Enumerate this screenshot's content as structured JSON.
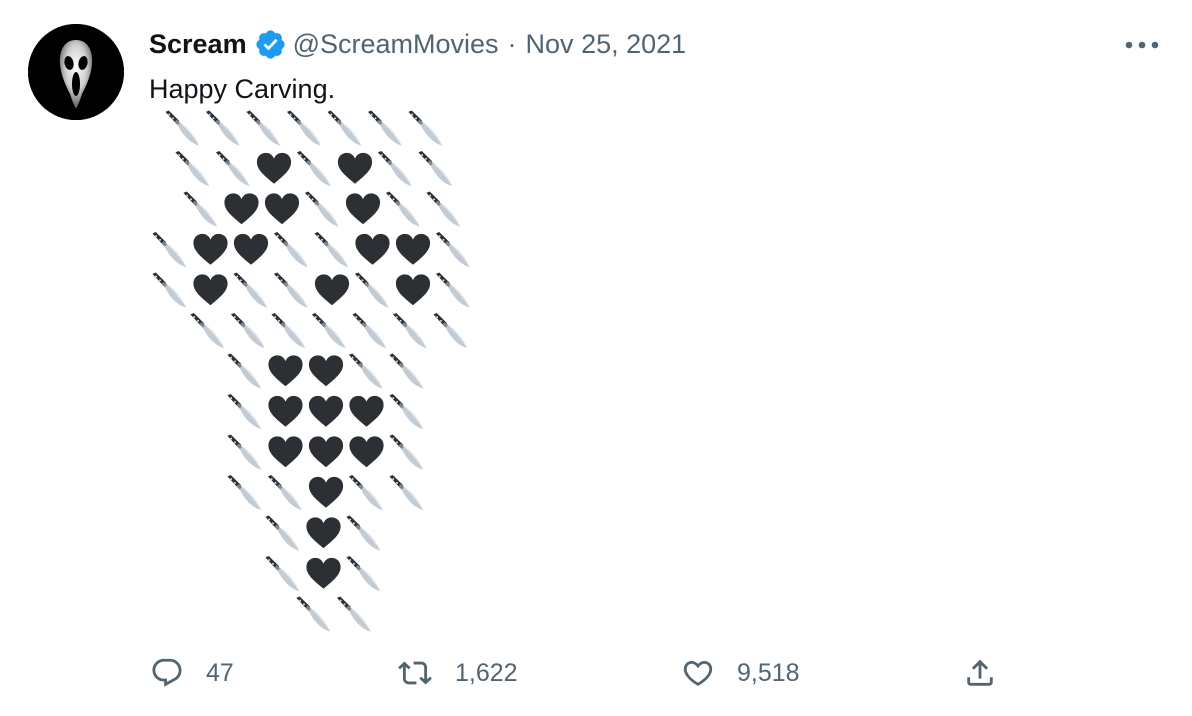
{
  "tweet": {
    "author_name": "Scream",
    "author_handle": "@ScreamMovies",
    "separator": "·",
    "date": "Nov 25, 2021",
    "text": "Happy Carving.",
    "emoji_art_rows": [
      "🔪🔪🔪🔪🔪🔪🔪",
      "🔪🔪🖤🔪🖤🔪🔪",
      "🔪🖤🖤🔪🖤🔪🔪",
      "🔪🖤🖤🔪🔪🖤🖤🔪",
      "🔪🖤🔪🔪🖤🔪🖤🔪",
      "🔪🔪🔪🔪🔪🔪🔪",
      "🔪🖤🖤🔪🔪",
      "🔪🖤🖤🖤🔪",
      "🔪🖤🖤🖤🔪",
      "🔪🔪🖤🔪🔪",
      "🔪🖤🔪",
      "🔪🖤🔪",
      "🔪🔪"
    ]
  },
  "actions": {
    "reply_count": "47",
    "retweet_count": "1,622",
    "like_count": "9,518"
  },
  "icons": {
    "verified": "verified-badge-icon",
    "more": "more-horizontal-icon",
    "reply": "reply-icon",
    "retweet": "retweet-icon",
    "like": "heart-icon",
    "share": "share-icon",
    "knife": "knife-emoji",
    "heart": "black-heart-emoji"
  },
  "colors": {
    "verified": "#1d9bf0",
    "secondary_text": "#536471",
    "primary_text": "#0f1419",
    "heart": "#2c2f33",
    "blade": "#c3ccd4",
    "handle": "#2b2f36"
  }
}
